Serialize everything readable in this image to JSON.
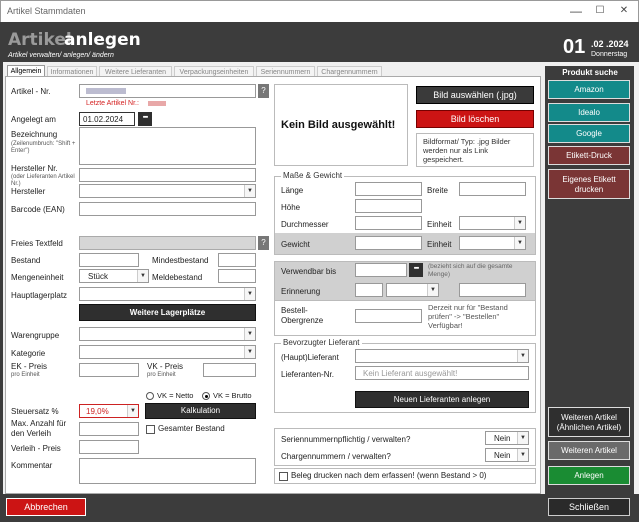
{
  "window": {
    "title": "Artikel Stammdaten",
    "minimize": "—",
    "maximize": "☐",
    "close": "✕"
  },
  "header": {
    "title_part1": "Artikel",
    "title_part2": "anlegen",
    "subtitle": "Artikel verwalten/ anlegen/ ändern",
    "day": "01",
    "month_year": ".02 .2024",
    "weekday": "Donnerstag"
  },
  "tabs": [
    "Allgemein",
    "Informationen",
    "Weitere Lieferanten",
    "Verpackungseinheiten",
    "Seriennummern",
    "Chargennummern"
  ],
  "form": {
    "artikel_nr_label": "Artikel - Nr.",
    "artikel_nr_value": "",
    "letzte_artikel_label": "Letzte Artikel Nr.: ",
    "angelegt_label": "Angelegt am",
    "angelegt_value": "01.02.2024",
    "bezeichnung_label": "Bezeichnung",
    "bezeichnung_hint": "(Zeilenumbruch: \"Shift + Enter\")",
    "hersteller_nr_label": "Hersteller Nr.",
    "hersteller_nr_hint": "(oder Lieferanten Artikel Nr.)",
    "hersteller_label": "Hersteller",
    "barcode_label": "Barcode (EAN)",
    "freies_textfeld_label": "Freies Textfeld",
    "bestand_label": "Bestand",
    "mindestbestand_label": "Mindestbestand",
    "mengeneinheit_label": "Mengeneinheit",
    "mengeneinheit_value": "Stück",
    "meldebestand_label": "Meldebestand",
    "hauptlagerplatz_label": "Hauptlagerplatz",
    "weitere_lagerplaetze_button": "Weitere Lagerplätze",
    "warengruppe_label": "Warengruppe",
    "kategorie_label": "Kategorie",
    "ek_preis_label": "EK - Preis",
    "ek_preis_hint": "pro Einheit",
    "vk_preis_label": "VK - Preis",
    "vk_preis_hint": "pro Einheit",
    "vk_netto_label": "VK = Netto",
    "vk_brutto_label": "VK = Brutto",
    "steuersatz_label": "Steuersatz %",
    "steuersatz_value": "19,0%",
    "kalkulation_button": "Kalkulation",
    "max_anzahl_label": "Max. Anzahl für den Verleih",
    "gesamter_bestand_label": "Gesamter Bestand",
    "verleih_preis_label": "Verleih - Preis",
    "kommentar_label": "Kommentar",
    "help_marker": "?",
    "calendar_marker": "▪▪▪"
  },
  "image": {
    "no_image_text": "Kein Bild ausgewählt!",
    "select_button": "Bild auswählen (.jpg)",
    "delete_button": "Bild löschen",
    "info": "Bildformat/ Typ: .jpg Bilder werden nur als Link gespeichert."
  },
  "dimensions": {
    "group_label": "Maße & Gewicht",
    "laenge": "Länge",
    "breite": "Breite",
    "hoehe": "Höhe",
    "durchmesser": "Durchmesser",
    "einheit1": "Einheit",
    "gewicht": "Gewicht",
    "einheit2": "Einheit"
  },
  "expiry": {
    "verwendbar_label": "Verwendbar bis",
    "verwendbar_hint": "(bezieht sich auf die gesamte Menge)",
    "erinnerung_label": "Erinnerung",
    "bestell_label": "Bestell-Obergrenze",
    "bestell_hint": "Derzeit nur für \"Bestand prüfen\" -> \"Bestellen\" Verfügbar!"
  },
  "supplier": {
    "group_label": "Bevorzugter Lieferant",
    "haupt_label": "(Haupt)Lieferant",
    "nr_label": "Lieferanten-Nr.",
    "nr_placeholder": "Kein Lieferant ausgewählt!",
    "new_button": "Neuen Lieferanten anlegen"
  },
  "options": {
    "serial_label": "Seriennummernpflichtig / verwalten?",
    "serial_value": "Nein",
    "charge_label": "Chargennummern / verwalten?",
    "charge_value": "Nein",
    "beleg_label": "Beleg drucken nach dem erfassen! (wenn Bestand > 0)"
  },
  "right_panel": {
    "title": "Produkt suche",
    "amazon": "Amazon",
    "idealo": "Idealo",
    "google": "Google",
    "etikett": "Etikett-Druck",
    "eigenes": "Eigenes Etikett drucken",
    "weiteren_aehnlich": "Weiteren Artikel (Ähnlichen Artikel)",
    "weiteren": "Weiteren Artikel",
    "anlegen": "Anlegen"
  },
  "footer": {
    "abbrechen": "Abbrechen",
    "schliessen": "Schließen"
  }
}
